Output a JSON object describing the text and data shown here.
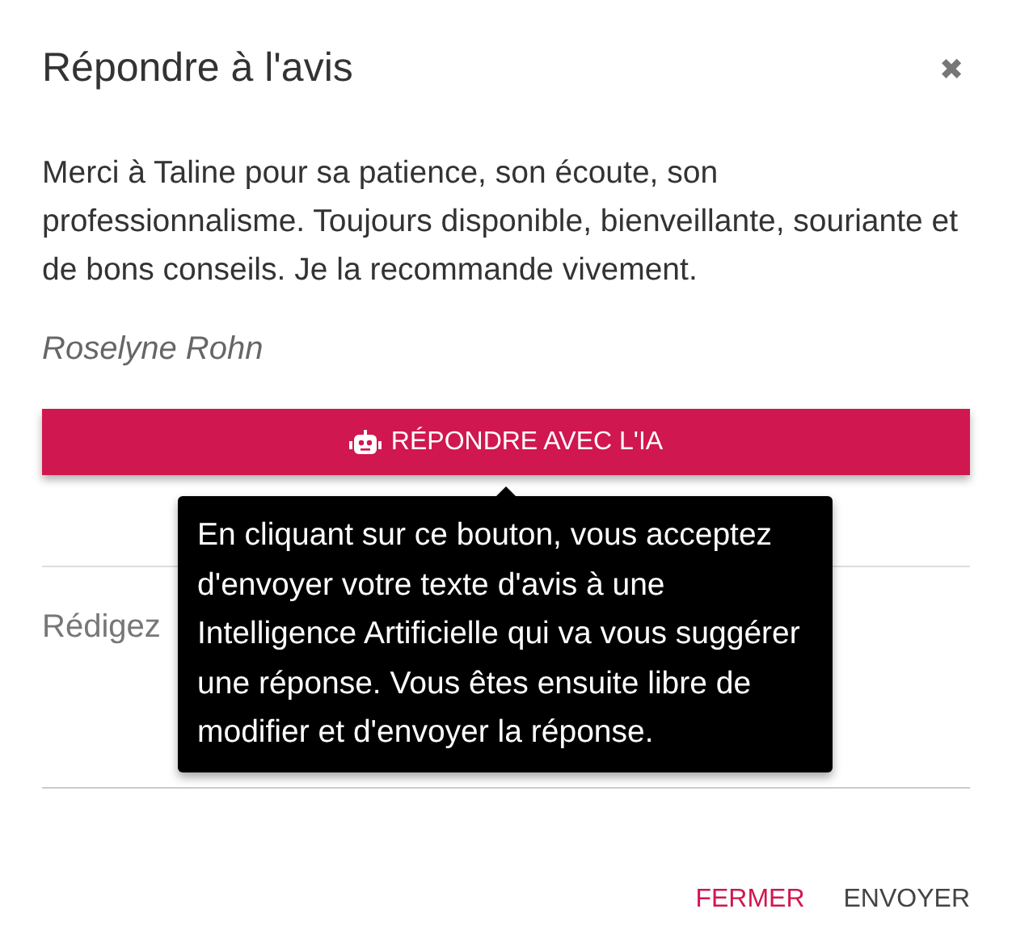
{
  "dialog": {
    "title": "Répondre à l'avis",
    "close": "✖"
  },
  "review": {
    "text": "Merci à Taline pour sa patience, son écoute, son professionnalisme. Toujours disponible, bienveillante, souriante et de bons conseils. Je la recommande vivement.",
    "author": "Roselyne Rohn"
  },
  "ai_button": {
    "label": "RÉPONDRE AVEC L'IA"
  },
  "tooltip": {
    "text": "En cliquant sur ce bouton, vous acceptez d'envoyer votre texte d'avis à une Intelligence Artificielle qui va vous suggérer une réponse. Vous êtes ensuite libre de modifier et d'envoyer la réponse."
  },
  "reply_field": {
    "placeholder": "Rédigez"
  },
  "buttons": [
    {
      "label": "FERMER",
      "kind": "cancel"
    },
    {
      "label": "ENVOYER",
      "kind": "submit"
    }
  ]
}
